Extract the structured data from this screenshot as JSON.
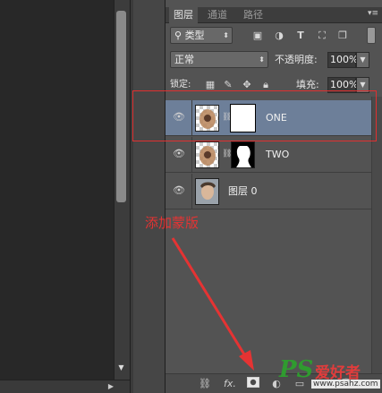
{
  "tabs": [
    {
      "label": "图层",
      "active": true
    },
    {
      "label": "通道",
      "active": false
    },
    {
      "label": "路径",
      "active": false
    }
  ],
  "filter": {
    "kind_label": "类型",
    "icons": [
      "image-filter-icon",
      "adjustment-filter-icon",
      "type-filter-icon",
      "shape-filter-icon",
      "smart-object-filter-icon"
    ]
  },
  "blend": {
    "mode": "正常",
    "opacity_label": "不透明度:",
    "opacity_value": "100%"
  },
  "lock": {
    "label": "锁定:",
    "fill_label": "填充:",
    "fill_value": "100%"
  },
  "layers": [
    {
      "name": "ONE",
      "selected": true,
      "has_mask": true,
      "mask": "white"
    },
    {
      "name": "TWO",
      "selected": false,
      "has_mask": true,
      "mask": "silhouette"
    },
    {
      "name": "图层 0",
      "selected": false,
      "has_mask": false
    }
  ],
  "footer": {
    "fx_label": "fx."
  },
  "annotation": {
    "text": "添加蒙版",
    "color": "#e53333"
  },
  "watermark": {
    "brand": "PS",
    "site_name": "爱好者",
    "url": "www.psahz.com"
  },
  "colors": {
    "panel": "#535353",
    "selected_layer": "#6d7f99",
    "annotation_red": "#e03030"
  }
}
